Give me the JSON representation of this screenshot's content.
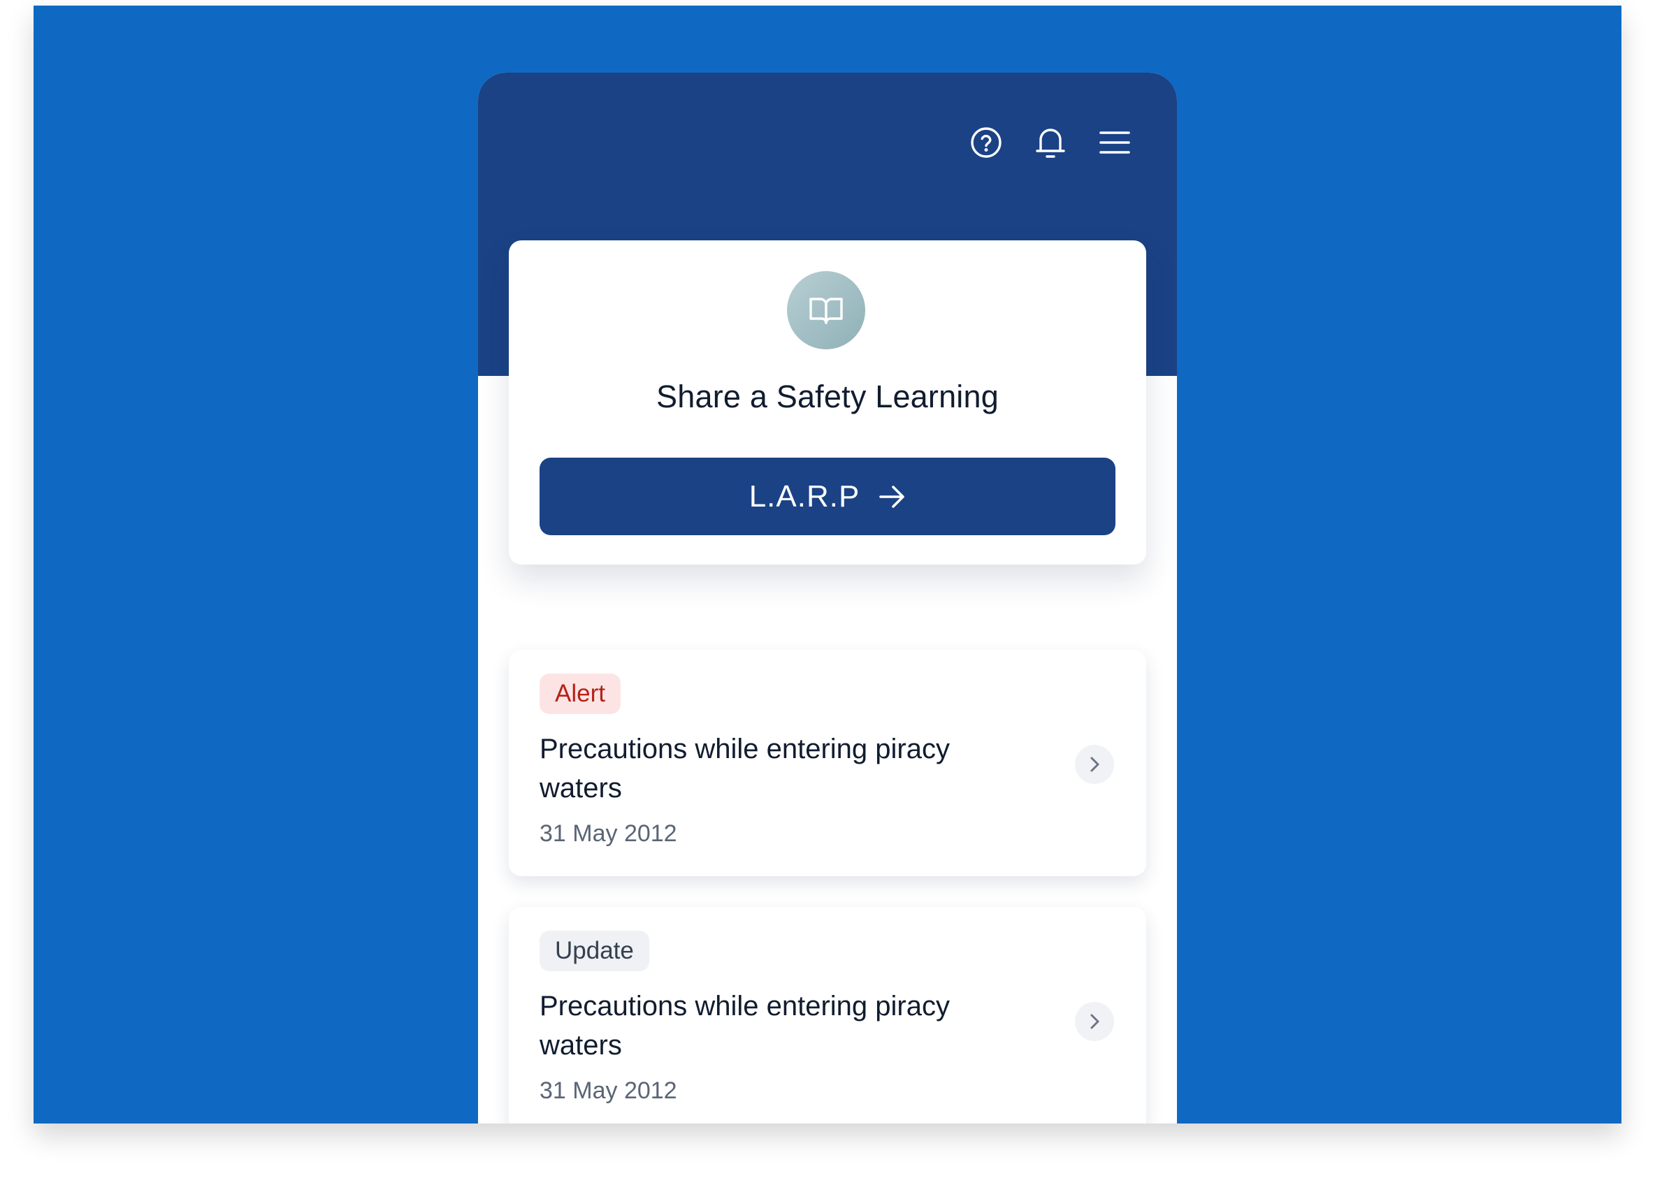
{
  "colors": {
    "background": "#0f69c2",
    "header": "#1a4285",
    "alert_badge_bg": "#fde4e4",
    "alert_badge_text": "#b42318",
    "update_badge_bg": "#eff1f4"
  },
  "header": {
    "icons": [
      "help-circle-icon",
      "bell-icon",
      "hamburger-menu-icon"
    ]
  },
  "hero": {
    "icon": "open-book-icon",
    "title": "Share a Safety Learning",
    "button_label": "L.A.R.P",
    "button_icon": "arrow-right-icon"
  },
  "feed": {
    "items": [
      {
        "badge": "Alert",
        "title": "Precautions while entering piracy waters",
        "date": "31 May 2012"
      },
      {
        "badge": "Update",
        "title": "Precautions while entering piracy waters",
        "date": "31 May 2012"
      }
    ]
  }
}
